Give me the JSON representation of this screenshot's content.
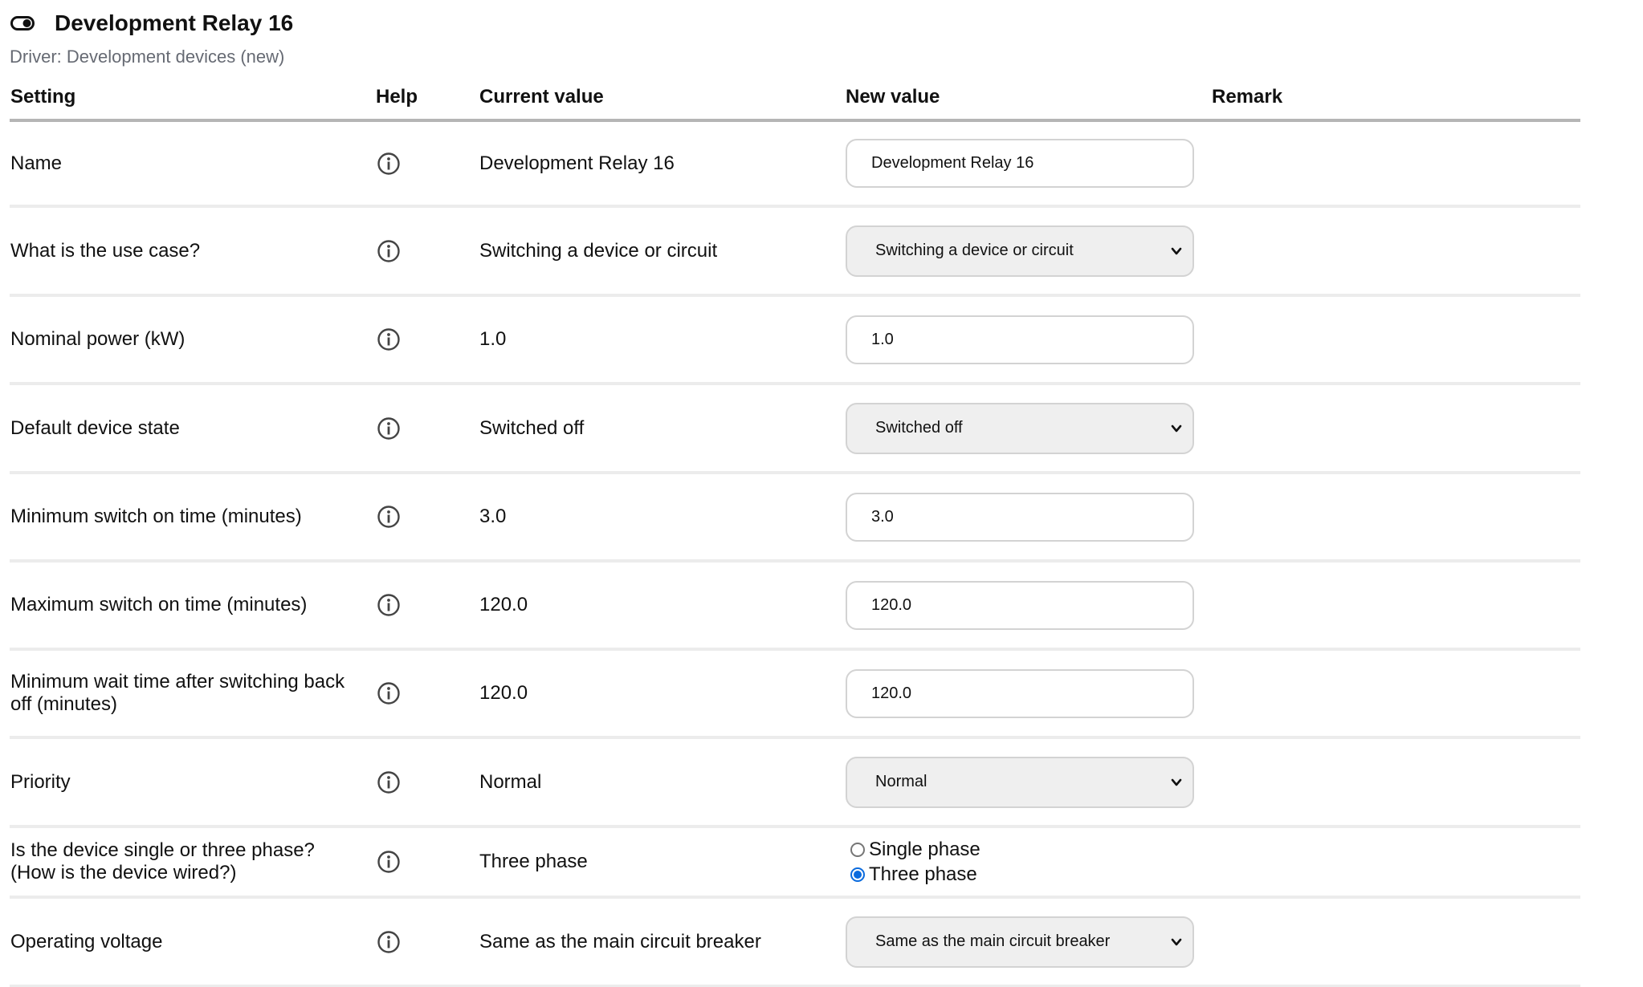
{
  "header": {
    "title": "Development Relay 16",
    "icon": "toggle-icon",
    "driver": "Driver: Development devices (new)"
  },
  "columns": {
    "setting": "Setting",
    "help": "Help",
    "current": "Current value",
    "new": "New value",
    "remark": "Remark"
  },
  "rows": {
    "name": {
      "label": "Name",
      "current": "Development Relay 16",
      "new_value": "Development Relay 16"
    },
    "use_case": {
      "label": "What is the use case?",
      "current": "Switching a device or circuit",
      "selected": "Switching a device or circuit"
    },
    "nominal_power": {
      "label": "Nominal power (kW)",
      "current": "1.0",
      "new_value": "1.0"
    },
    "default_state": {
      "label": "Default device state",
      "current": "Switched off",
      "selected": "Switched off"
    },
    "min_on": {
      "label": "Minimum switch on time (minutes)",
      "current": "3.0",
      "new_value": "3.0"
    },
    "max_on": {
      "label": "Maximum switch on time (minutes)",
      "current": "120.0",
      "new_value": "120.0"
    },
    "min_wait": {
      "label": "Minimum wait time after switching back off (minutes)",
      "current": "120.0",
      "new_value": "120.0"
    },
    "priority": {
      "label": "Priority",
      "current": "Normal",
      "selected": "Normal"
    },
    "phase": {
      "label_line1": "Is the device single or three phase?",
      "label_line2": "(How is the device wired?)",
      "current": "Three phase",
      "option_single": "Single phase",
      "option_three": "Three phase",
      "selected": "Three phase"
    },
    "voltage": {
      "label": "Operating voltage",
      "current": "Same as the main circuit breaker",
      "selected": "Same as the main circuit breaker"
    }
  },
  "colors": {
    "accent_radio": "#0b6bde",
    "muted_text": "#666a73",
    "header_rule": "#b5b5b5",
    "row_rule": "#ececec",
    "select_bg": "#efefef"
  }
}
